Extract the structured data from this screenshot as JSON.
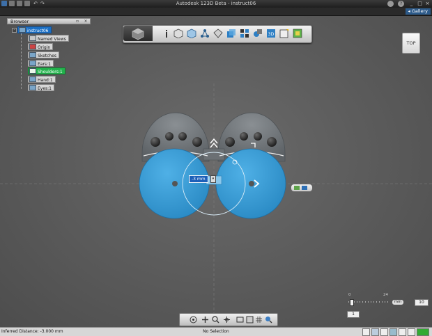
{
  "window": {
    "title": "Autodesk 123D Beta  -  instruct06",
    "gallery_label": "Gallery",
    "minimize": "_",
    "maximize": "□",
    "close": "×",
    "help_label": "?"
  },
  "browser": {
    "header": "Browser",
    "items": [
      {
        "label": "instruct06",
        "state": "root"
      },
      {
        "label": "Named Views",
        "state": "normal"
      },
      {
        "label": "Origin",
        "state": "normal"
      },
      {
        "label": "Sketches",
        "state": "normal"
      },
      {
        "label": "Ears:1",
        "state": "normal"
      },
      {
        "label": "Shoulders:1",
        "state": "selected"
      },
      {
        "label": "Hand:1",
        "state": "normal"
      },
      {
        "label": "Eyes:1",
        "state": "normal"
      }
    ]
  },
  "viewcube": {
    "label": "TOP"
  },
  "dimension": {
    "value": "-3 mm"
  },
  "slider": {
    "tick_min": "0",
    "tick_max": "24",
    "unit": "mm",
    "value": "10",
    "step_value": "1"
  },
  "status": {
    "left": "Inferred Distance: -3.000 mm",
    "center": "No Selection"
  },
  "colors": {
    "accent_blue": "#3d9fd8",
    "selection_green": "#22b24c",
    "root_blue": "#1b6fc4",
    "body_gray": "#6e7377"
  },
  "toolbar": {
    "icons": [
      "home-icon",
      "info-icon",
      "primitives-icon",
      "sketch-icon",
      "construct-icon",
      "modify-icon",
      "pattern-icon",
      "grouping-icon",
      "combine-icon",
      "measure-icon",
      "text-icon",
      "material-icon"
    ]
  },
  "navbar": {
    "icons": [
      "orbit-icon",
      "pan-icon",
      "zoom-icon",
      "fit-icon",
      "view-icon",
      "display-icon",
      "grid-icon",
      "snap-icon"
    ]
  }
}
